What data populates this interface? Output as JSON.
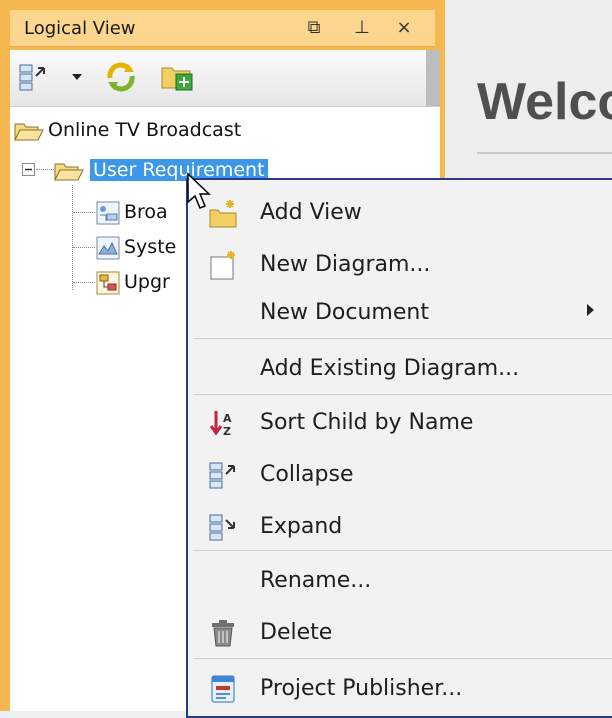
{
  "panel": {
    "title": "Logical View",
    "header_icons": [
      "restore-icon",
      "pin-icon",
      "close-icon"
    ],
    "header_glyphs": {
      "restore": "⧉",
      "pin": "⊥",
      "close": "×"
    }
  },
  "toolbar": {
    "buttons": [
      "collapse-tree-icon",
      "dropdown-arrow-icon",
      "refresh-icon",
      "add-view-icon"
    ]
  },
  "tree": {
    "root": {
      "label": "Online TV Broadcast"
    },
    "selected": {
      "label": "User Requirement"
    },
    "children": [
      {
        "label": "Broa",
        "icon": "use-case-diagram-icon"
      },
      {
        "label": "Syste",
        "icon": "system-diagram-icon"
      },
      {
        "label": "Upgr",
        "icon": "activity-diagram-icon"
      }
    ]
  },
  "main": {
    "welcome": "Welco"
  },
  "context_menu": {
    "items": [
      {
        "label": "Add View",
        "icon": "add-view-icon"
      },
      {
        "label": "New Diagram...",
        "icon": "new-diagram-icon"
      },
      {
        "label": "New Document",
        "icon": "",
        "submenu": true
      },
      {
        "label": "Add Existing Diagram...",
        "icon": ""
      },
      {
        "label": "Sort Child by Name",
        "icon": "sort-az-icon"
      },
      {
        "label": "Collapse",
        "icon": "collapse-icon"
      },
      {
        "label": "Expand",
        "icon": "expand-icon"
      },
      {
        "label": "Rename...",
        "icon": ""
      },
      {
        "label": "Delete",
        "icon": "trash-icon"
      },
      {
        "label": "Project Publisher...",
        "icon": "publisher-icon"
      }
    ]
  },
  "colors": {
    "panel_accent": "#f6b74f",
    "selection": "#3d97e8",
    "menu_border": "#2a3a8e"
  }
}
